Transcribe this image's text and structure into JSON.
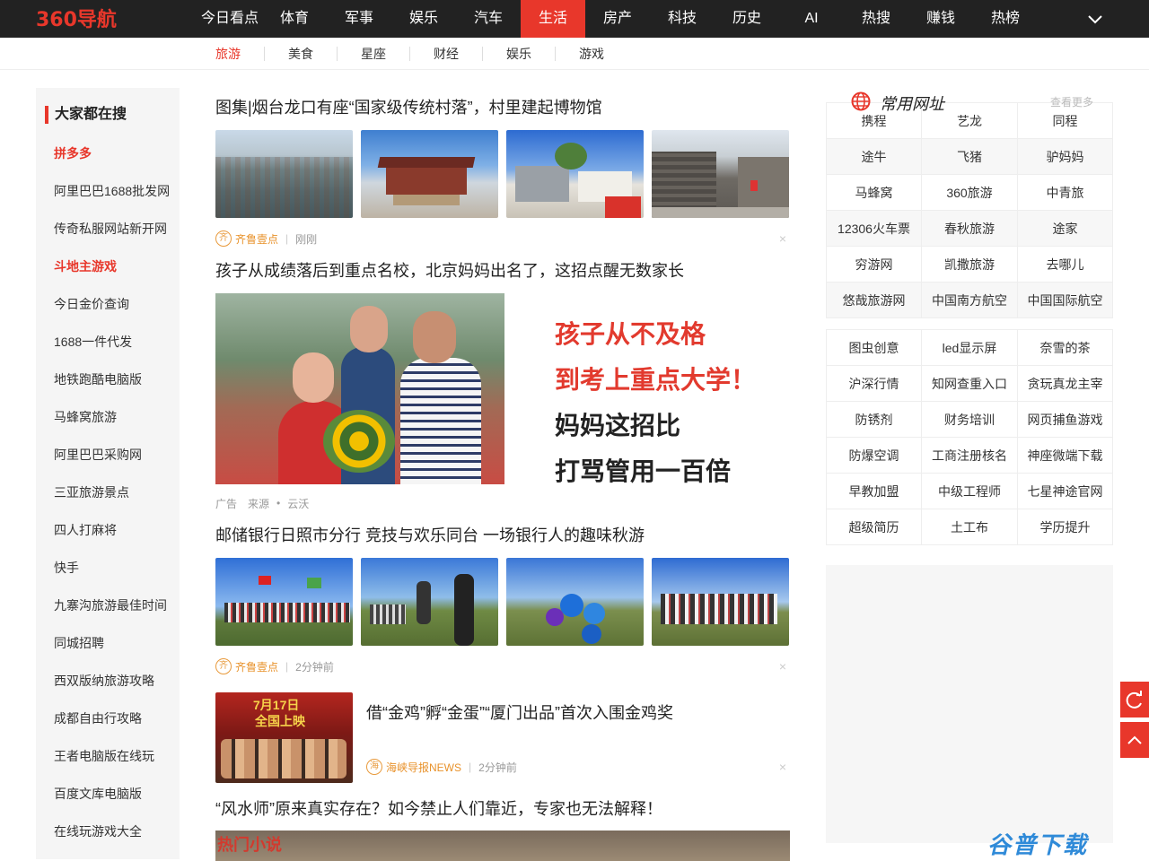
{
  "topnav": {
    "logo_text": "360导航",
    "items": [
      {
        "label": "今日看点"
      },
      {
        "label": "体育"
      },
      {
        "label": "军事"
      },
      {
        "label": "娱乐"
      },
      {
        "label": "汽车"
      },
      {
        "label": "生活",
        "active": true
      },
      {
        "label": "房产"
      },
      {
        "label": "科技"
      },
      {
        "label": "历史"
      },
      {
        "label": "AI"
      },
      {
        "label": "热搜"
      },
      {
        "label": "赚钱"
      },
      {
        "label": "热榜"
      }
    ],
    "more_icon": "chevron-down-icon",
    "accent_color": "#e8372b"
  },
  "subnav": {
    "items": [
      {
        "label": "旅游",
        "active": true
      },
      {
        "label": "美食"
      },
      {
        "label": "星座"
      },
      {
        "label": "财经"
      },
      {
        "label": "娱乐"
      },
      {
        "label": "游戏"
      }
    ]
  },
  "sidebar": {
    "title": "大家都在搜",
    "items": [
      {
        "label": "拼多多",
        "hot": true
      },
      {
        "label": "阿里巴巴1688批发网"
      },
      {
        "label": "传奇私服网站新开网"
      },
      {
        "label": "斗地主游戏",
        "hot": true
      },
      {
        "label": "今日金价查询"
      },
      {
        "label": "1688一件代发"
      },
      {
        "label": "地铁跑酷电脑版"
      },
      {
        "label": "马蜂窝旅游"
      },
      {
        "label": "阿里巴巴采购网"
      },
      {
        "label": "三亚旅游景点"
      },
      {
        "label": "四人打麻将"
      },
      {
        "label": "快手"
      },
      {
        "label": "九寨沟旅游最佳时间"
      },
      {
        "label": "同城招聘"
      },
      {
        "label": "西双版纳旅游攻略"
      },
      {
        "label": "成都自由行攻略"
      },
      {
        "label": "王者电脑版在线玩"
      },
      {
        "label": "百度文库电脑版"
      },
      {
        "label": "在线玩游戏大全"
      }
    ]
  },
  "feed": {
    "news1": {
      "title": "图集|烟台龙口有座“国家级传统村落”，村里建起博物馆",
      "source": "齐鲁壹点",
      "time": "刚刚",
      "src_icon_char": "齐"
    },
    "news2": {
      "title": "孩子从成绩落后到重点名校，北京妈妈出名了，这招点醒无数家长",
      "ad_label": "广告",
      "source_label": "来源",
      "dot": "•",
      "source": "云沃",
      "ad_lines": [
        "孩子从不及格",
        "到考上重点大学！",
        "妈妈这招比",
        "打骂管用一百倍"
      ]
    },
    "news3": {
      "title": "邮储银行日照市分行 竞技与欢乐同台 一场银行人的趣味秋游",
      "source": "齐鲁壹点",
      "time": "2分钟前",
      "src_icon_char": "齐"
    },
    "news4": {
      "title": "借“金鸡”孵“金蛋”“厦门出品”首次入围金鸡奖",
      "source": "海峡导报NEWS",
      "time": "2分钟前",
      "src_icon_char": "海",
      "thumb_text_1": "7月17日",
      "thumb_text_2": "全国上映"
    },
    "news5": {
      "title": "“风水师”原来真实存在？如今禁止人们靠近，专家也无法解释！",
      "thumb_text": "热门小说"
    },
    "close_glyph": "×"
  },
  "right": {
    "urlbox": {
      "title": "常用网址",
      "more": "查看更多",
      "links": [
        "携程",
        "艺龙",
        "同程",
        "途牛",
        "飞猪",
        "驴妈妈",
        "马蜂窝",
        "360旅游",
        "中青旅",
        "12306火车票",
        "春秋旅游",
        "途家",
        "穷游网",
        "凯撒旅游",
        "去哪儿",
        "悠哉旅游网",
        "中国南方航空",
        "中国国际航空"
      ]
    },
    "hotbox": {
      "links": [
        "图虫创意",
        "led显示屏",
        "奈雪的茶",
        "沪深行情",
        "知网查重入口",
        "贪玩真龙主宰",
        "防锈剂",
        "财务培训",
        "网页捕鱼游戏",
        "防爆空调",
        "工商注册核名",
        "神座微端下载",
        "早教加盟",
        "中级工程师",
        "七星神途官网",
        "超级简历",
        "土工布",
        "学历提升"
      ]
    }
  },
  "floating": {
    "refresh_icon": "refresh-icon",
    "top_icon": "back-to-top-icon"
  },
  "watermark": "谷普下载"
}
